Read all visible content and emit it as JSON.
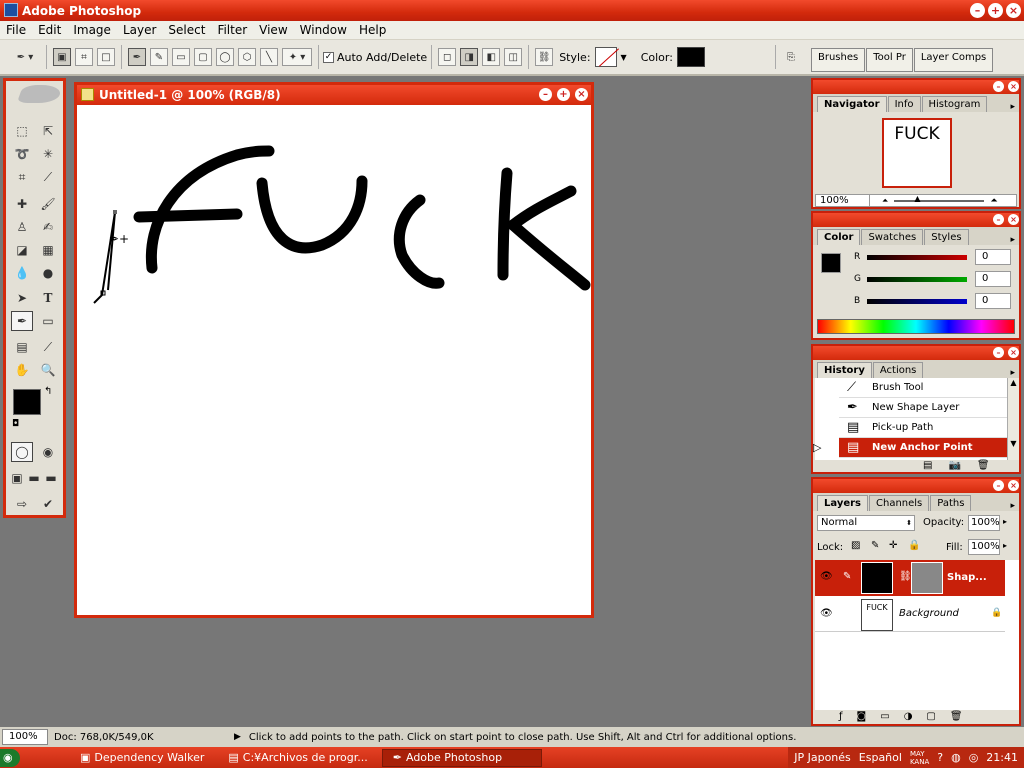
{
  "app": {
    "title": "Adobe Photoshop"
  },
  "menu": [
    "File",
    "Edit",
    "Image",
    "Layer",
    "Select",
    "Filter",
    "View",
    "Window",
    "Help"
  ],
  "options": {
    "auto_add_delete": "Auto Add/Delete",
    "style_label": "Style:",
    "color_label": "Color:"
  },
  "palette_well": [
    "Brushes",
    "Tool Pr",
    "Layer Comps"
  ],
  "document": {
    "title": "Untitled-1 @ 100% (RGB/8)"
  },
  "navigator": {
    "tabs": [
      "Navigator",
      "Info",
      "Histogram"
    ],
    "zoom": "100%",
    "thumb_text": "FUCK"
  },
  "color": {
    "tabs": [
      "Color",
      "Swatches",
      "Styles"
    ],
    "r_label": "R",
    "g_label": "G",
    "b_label": "B",
    "r": "0",
    "g": "0",
    "b": "0"
  },
  "history": {
    "tabs": [
      "History",
      "Actions"
    ],
    "items": [
      "Brush Tool",
      "New Shape Layer",
      "Pick-up Path",
      "New Anchor Point"
    ]
  },
  "layers": {
    "tabs": [
      "Layers",
      "Channels",
      "Paths"
    ],
    "blend": "Normal",
    "opacity_label": "Opacity:",
    "opacity": "100%",
    "lock_label": "Lock:",
    "fill_label": "Fill:",
    "fill": "100%",
    "rows": [
      "Shap...",
      "Background"
    ],
    "bg_thumb_text": "FUCK"
  },
  "status": {
    "zoom": "100%",
    "doc": "Doc: 768,0K/549,0K",
    "hint": "Click to add points to the path.  Click on start point to close path.  Use Shift, Alt and Ctrl for additional options."
  },
  "taskbar": {
    "tasks": [
      "Dependency Walker",
      "C:¥Archivos de progr...",
      "Adobe Photoshop"
    ],
    "ime": "JP Japonés",
    "lang": "Español",
    "ime_mode": "MAY",
    "ime_mode2": "KANA",
    "time": "21:41"
  },
  "colors": {
    "accent": "#d32a0c",
    "red": "#cc0000",
    "green": "#00aa00",
    "blue": "#0000cc"
  }
}
